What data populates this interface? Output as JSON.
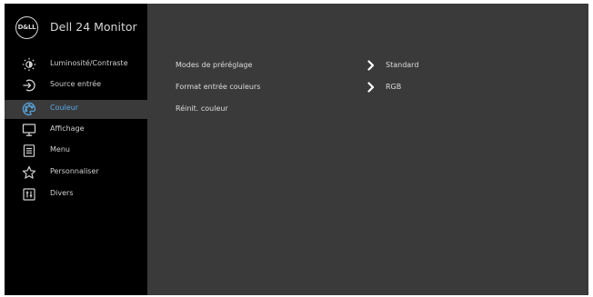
{
  "header": {
    "brand_logo": "D&LL",
    "model_name": "Dell 24 Monitor"
  },
  "sidebar": {
    "items": [
      {
        "label": "Luminosité/Contraste",
        "icon": "brightness-icon",
        "active": false
      },
      {
        "label": "Source entrée",
        "icon": "input-source-icon",
        "active": false
      },
      {
        "label": "Couleur",
        "icon": "color-palette-icon",
        "active": true
      },
      {
        "label": "Affichage",
        "icon": "display-icon",
        "active": false
      },
      {
        "label": "Menu",
        "icon": "menu-list-icon",
        "active": false
      },
      {
        "label": "Personnaliser",
        "icon": "star-icon",
        "active": false
      },
      {
        "label": "Divers",
        "icon": "others-icon",
        "active": false
      }
    ]
  },
  "content": {
    "rows": [
      {
        "label": "Modes de préréglage",
        "value": "Standard"
      },
      {
        "label": "Format entrée couleurs",
        "value": "RGB"
      },
      {
        "label": "Réinit. couleur",
        "value": ""
      }
    ]
  },
  "colors": {
    "sidebar_bg": "#000000",
    "panel_bg": "#3a3a3a",
    "active_text": "#5aa9e6",
    "text": "#d0d0d0"
  }
}
